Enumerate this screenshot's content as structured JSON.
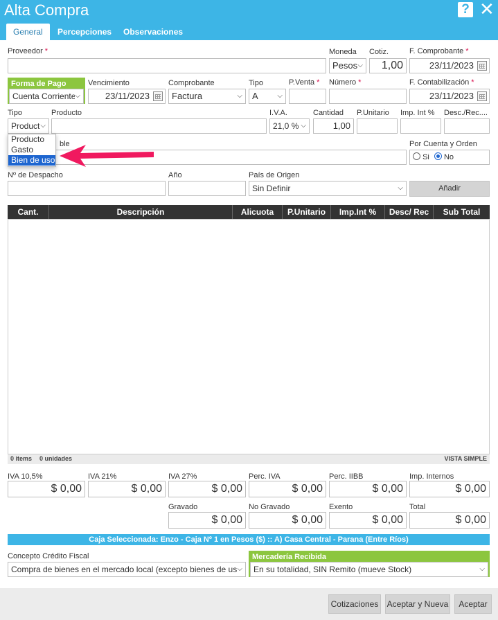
{
  "window": {
    "title": "Alta Compra",
    "help_icon": "question-icon",
    "close_icon": "close-icon"
  },
  "tabs": [
    {
      "label": "General",
      "active": true
    },
    {
      "label": "Percepciones",
      "active": false
    },
    {
      "label": "Observaciones",
      "active": false
    }
  ],
  "fields": {
    "proveedor": {
      "label": "Proveedor",
      "value": ""
    },
    "moneda": {
      "label": "Moneda",
      "value": "Pesos"
    },
    "cotiz": {
      "label": "Cotiz.",
      "value": "1,00"
    },
    "f_comprobante": {
      "label": "F. Comprobante",
      "value": "23/11/2023"
    },
    "forma_pago": {
      "label": "Forma de Pago",
      "value": "Cuenta Corriente"
    },
    "vencimiento": {
      "label": "Vencimiento",
      "value": "23/11/2023"
    },
    "comprobante": {
      "label": "Comprobante",
      "value": "Factura"
    },
    "tipo_comp": {
      "label": "Tipo",
      "value": "A"
    },
    "pventa": {
      "label": "P.Venta",
      "value": ""
    },
    "numero": {
      "label": "Número",
      "value": ""
    },
    "f_contabilizacion": {
      "label": "F. Contabilización",
      "value": "23/11/2023"
    },
    "tipo_item": {
      "label": "Tipo",
      "value": "Producto"
    },
    "producto": {
      "label": "Producto",
      "value": ""
    },
    "iva": {
      "label": "I.V.A.",
      "value": "21,0 %"
    },
    "cantidad": {
      "label": "Cantidad",
      "value": "1,00"
    },
    "punitario": {
      "label": "P.Unitario",
      "value": ""
    },
    "imp_int": {
      "label": "Imp. Int %",
      "value": ""
    },
    "desc_rec": {
      "label": "Desc./Rec....",
      "value": ""
    },
    "hidden_label_tail": "ble",
    "por_cuenta": {
      "label": "Por Cuenta y Orden",
      "opt_si": "Si",
      "opt_no": "No",
      "selected": "No"
    },
    "despacho": {
      "label": "Nº de Despacho",
      "value": ""
    },
    "anio": {
      "label": "Año",
      "value": ""
    },
    "pais": {
      "label": "País de Origen",
      "value": "Sin Definir"
    },
    "anadir": "Añadir"
  },
  "tipo_dropdown": {
    "options": [
      "Producto",
      "Gasto",
      "Bien de uso"
    ],
    "highlighted": "Bien de uso"
  },
  "table": {
    "columns": [
      "Cant.",
      "Descripción",
      "Alicuota",
      "P.Unitario",
      "Imp.Int %",
      "Desc/ Rec",
      "Sub Total"
    ],
    "rows": [],
    "footer": {
      "items": "0 items",
      "units": "0 unidades",
      "view": "VISTA SIMPLE"
    }
  },
  "totals": {
    "iva105": {
      "label": "IVA 10,5%",
      "value": "$ 0,00"
    },
    "iva21": {
      "label": "IVA 21%",
      "value": "$ 0,00"
    },
    "iva27": {
      "label": "IVA 27%",
      "value": "$ 0,00"
    },
    "perc_iva": {
      "label": "Perc. IVA",
      "value": "$ 0,00"
    },
    "perc_iibb": {
      "label": "Perc. IIBB",
      "value": "$ 0,00"
    },
    "imp_internos": {
      "label": "Imp. Internos",
      "value": "$ 0,00"
    },
    "gravado": {
      "label": "Gravado",
      "value": "$ 0,00"
    },
    "no_gravado": {
      "label": "No Gravado",
      "value": "$ 0,00"
    },
    "exento": {
      "label": "Exento",
      "value": "$ 0,00"
    },
    "total": {
      "label": "Total",
      "value": "$ 0,00"
    }
  },
  "caja": "Caja Seleccionada: Enzo - Caja Nº 1 en Pesos ($) :: A) Casa Central - Parana (Entre Ríos)",
  "concepto": {
    "label": "Concepto Crédito Fiscal",
    "value": "Compra de bienes en el mercado local (excepto bienes de us"
  },
  "mercaderia": {
    "label": "Mercadería Recibida",
    "value": "En su totalidad, SIN Remito (mueve Stock)"
  },
  "buttons": {
    "cotizaciones": "Cotizaciones",
    "aceptar_nueva": "Aceptar y Nueva",
    "aceptar": "Aceptar"
  },
  "colors": {
    "header": "#3db5e6",
    "green": "#8cc63f",
    "required": "#d9114d",
    "arrow": "#f0195f"
  }
}
